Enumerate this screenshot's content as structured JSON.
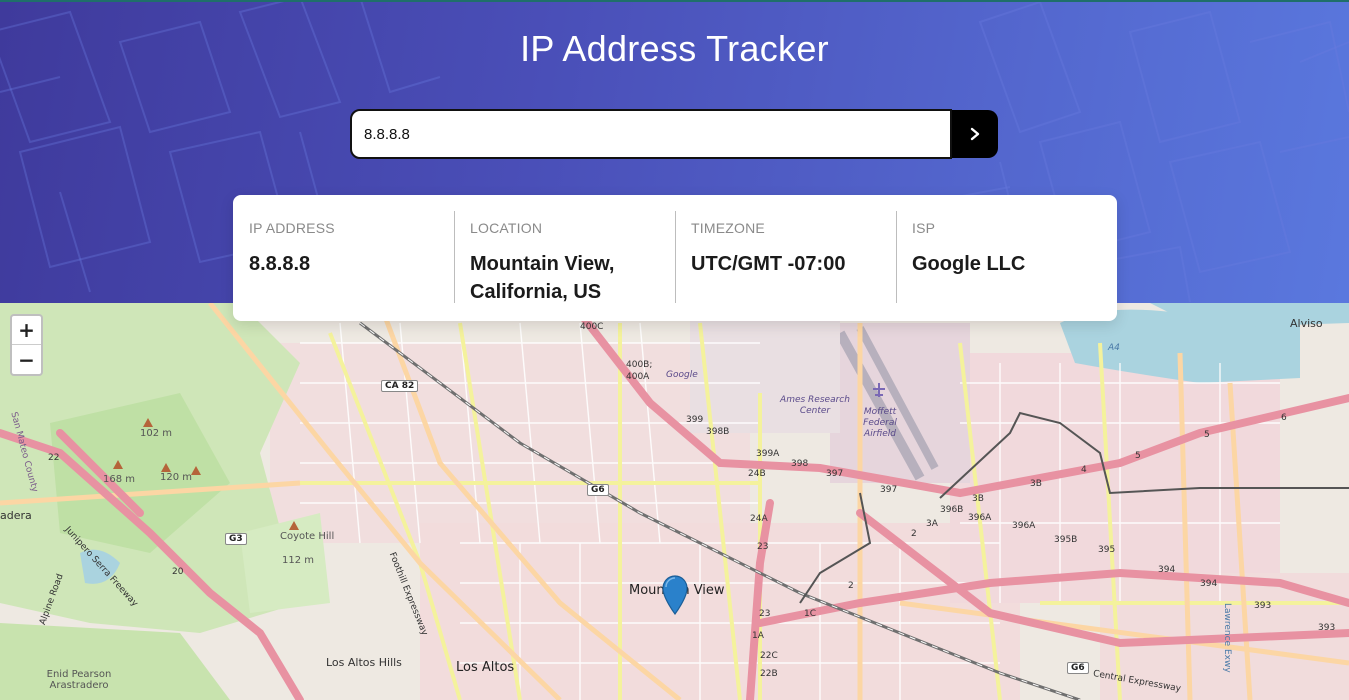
{
  "app": {
    "title": "IP Address Tracker"
  },
  "search": {
    "value": "8.8.8.8",
    "button_icon": "chevron-right-icon"
  },
  "info": [
    {
      "label": "IP ADDRESS",
      "value": "8.8.8.8"
    },
    {
      "label": "LOCATION",
      "value": "Mountain View, California, US"
    },
    {
      "label": "TIMEZONE",
      "value": "UTC/GMT -07:00"
    },
    {
      "label": "ISP",
      "value": "Google LLC"
    }
  ],
  "map": {
    "zoom_in": "+",
    "zoom_out": "−",
    "marker_icon": "location-pin-icon",
    "labels": {
      "city_mountain_view": "Mountain View",
      "city_los_altos": "Los Altos",
      "city_los_altos_hills": "Los Altos Hills",
      "city_alviso": "Alviso",
      "city_adera": "adera",
      "poi_ames": "Ames Research Center",
      "poi_moffett": "Moffett Federal Airfield",
      "poi_google": "Google",
      "poi_coyote_hill": "Coyote Hill",
      "poi_coyote_hill_elev": "112 m",
      "poi_enid": "Enid Pearson Arastradero",
      "elev_102": "102 m",
      "elev_120": "120 m",
      "elev_168": "168 m",
      "road_ca82": "CA 82",
      "road_g6_a": "G6",
      "road_g6_b": "G6",
      "road_g3": "G3",
      "road_a4": "A4",
      "exit_400c": "400C",
      "exit_400b": "400B;",
      "exit_400a": "400A",
      "exit_399": "399",
      "exit_398b": "398B",
      "exit_399a": "399A",
      "exit_398": "398",
      "exit_397": "397",
      "exit_397b": "397",
      "exit_24b": "24B",
      "exit_24a": "24A",
      "exit_23": "23",
      "exit_23b": "23",
      "exit_1a": "1A",
      "exit_1c": "1C",
      "exit_22c": "22C",
      "exit_22b": "22B",
      "exit_2": "2",
      "exit_2b": "2",
      "exit_3a": "3A",
      "exit_3b": "3B",
      "exit_3bb": "3B",
      "exit_396b": "396B",
      "exit_396a": "396A",
      "exit_396aa": "396A",
      "exit_395b": "395B",
      "exit_395": "395",
      "exit_394": "394",
      "exit_394b": "394",
      "exit_393": "393",
      "exit_393b": "393",
      "exit_4": "4",
      "exit_5": "5",
      "exit_5b": "5",
      "exit_6": "6",
      "exit_20": "20",
      "exit_22": "22",
      "road_junipero": "Junipero Serra Freeway",
      "road_foothill": "Foothill Expressway",
      "road_central": "Central Expressway",
      "road_alpine": "Alpine Road",
      "road_lawrence": "Lawrence Exwy",
      "county_san_mateo": "San Mateo County"
    }
  }
}
